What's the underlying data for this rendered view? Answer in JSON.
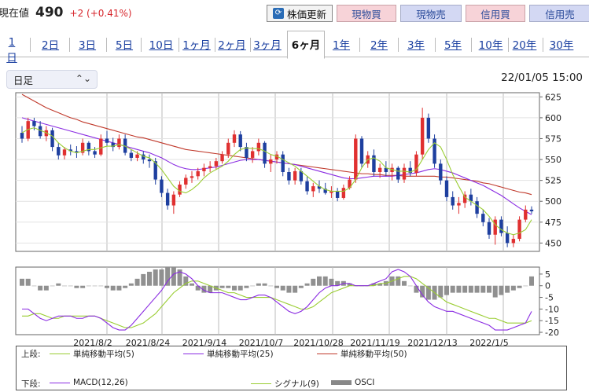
{
  "quote": {
    "label": "現在値",
    "price": "490",
    "change": "+2 (+0.41%)"
  },
  "buttons": {
    "update": "株価更新",
    "buy_cash": "現物買",
    "sell_cash": "現物売",
    "buy_margin": "信用買",
    "sell_margin": "信用売"
  },
  "tabs": [
    "1日",
    "2日",
    "3日",
    "5日",
    "10日",
    "1ヶ月",
    "2ヶ月",
    "3ヶ月",
    "6ヶ月",
    "1年",
    "2年",
    "3年",
    "5年",
    "10年",
    "20年",
    "30年"
  ],
  "active_tab": "6ヶ月",
  "period_select": "日足",
  "datetime": "22/01/05 15:00",
  "colors": {
    "up": "#e03030",
    "down": "#1e3f9f",
    "ma5": "#9acd32",
    "ma25": "#8a2be2",
    "ma50": "#c0392b",
    "macd": "#8a2be2",
    "signal": "#9acd32",
    "osci": "#909090"
  },
  "chart_data": [
    {
      "type": "line",
      "title": "",
      "price_axis": {
        "ticks": [
          "625",
          "600",
          "575",
          "550",
          "525",
          "500",
          "475",
          "450"
        ],
        "ylim": [
          440,
          630
        ]
      },
      "x_dates": [
        "2021/8/2",
        "2021/8/24",
        "2021/9/14",
        "2021/10/7",
        "2021/10/28",
        "2021/11/19",
        "2021/12/13",
        "2022/1/5"
      ],
      "candles": [
        [
          582,
          590,
          570,
          575
        ],
        [
          575,
          600,
          572,
          596
        ],
        [
          596,
          600,
          585,
          590
        ],
        [
          590,
          596,
          575,
          578
        ],
        [
          578,
          590,
          572,
          585
        ],
        [
          585,
          588,
          560,
          565
        ],
        [
          565,
          570,
          550,
          555
        ],
        [
          555,
          565,
          550,
          562
        ],
        [
          562,
          568,
          555,
          560
        ],
        [
          560,
          566,
          552,
          558
        ],
        [
          558,
          575,
          555,
          570
        ],
        [
          570,
          572,
          555,
          560
        ],
        [
          560,
          565,
          552,
          556
        ],
        [
          556,
          580,
          554,
          575
        ],
        [
          575,
          584,
          566,
          570
        ],
        [
          570,
          576,
          560,
          565
        ],
        [
          565,
          580,
          562,
          575
        ],
        [
          575,
          580,
          555,
          558
        ],
        [
          558,
          562,
          548,
          552
        ],
        [
          552,
          560,
          548,
          556
        ],
        [
          556,
          560,
          545,
          550
        ],
        [
          550,
          556,
          540,
          548
        ],
        [
          548,
          552,
          520,
          526
        ],
        [
          526,
          530,
          505,
          510
        ],
        [
          510,
          515,
          490,
          495
        ],
        [
          495,
          512,
          485,
          508
        ],
        [
          508,
          524,
          505,
          520
        ],
        [
          520,
          532,
          515,
          528
        ],
        [
          528,
          536,
          522,
          530
        ],
        [
          530,
          540,
          526,
          536
        ],
        [
          536,
          545,
          530,
          540
        ],
        [
          540,
          548,
          535,
          542
        ],
        [
          542,
          552,
          538,
          548
        ],
        [
          548,
          560,
          545,
          556
        ],
        [
          556,
          575,
          552,
          570
        ],
        [
          570,
          585,
          565,
          580
        ],
        [
          580,
          584,
          560,
          565
        ],
        [
          565,
          570,
          548,
          552
        ],
        [
          552,
          565,
          546,
          560
        ],
        [
          560,
          575,
          555,
          570
        ],
        [
          570,
          572,
          540,
          545
        ],
        [
          545,
          556,
          535,
          550
        ],
        [
          550,
          560,
          545,
          556
        ],
        [
          556,
          560,
          530,
          535
        ],
        [
          535,
          540,
          520,
          525
        ],
        [
          525,
          540,
          520,
          536
        ],
        [
          536,
          540,
          520,
          524
        ],
        [
          524,
          530,
          508,
          512
        ],
        [
          512,
          522,
          505,
          518
        ],
        [
          518,
          525,
          510,
          515
        ],
        [
          515,
          522,
          508,
          510
        ],
        [
          510,
          518,
          504,
          512
        ],
        [
          512,
          516,
          500,
          504
        ],
        [
          504,
          520,
          502,
          516
        ],
        [
          516,
          530,
          514,
          526
        ],
        [
          526,
          580,
          522,
          575
        ],
        [
          575,
          578,
          540,
          545
        ],
        [
          545,
          560,
          540,
          555
        ],
        [
          555,
          562,
          530,
          535
        ],
        [
          535,
          545,
          528,
          540
        ],
        [
          540,
          548,
          530,
          535
        ],
        [
          535,
          545,
          525,
          540
        ],
        [
          540,
          542,
          522,
          526
        ],
        [
          526,
          545,
          522,
          540
        ],
        [
          540,
          548,
          530,
          534
        ],
        [
          534,
          560,
          530,
          556
        ],
        [
          556,
          612,
          550,
          600
        ],
        [
          600,
          605,
          570,
          575
        ],
        [
          575,
          580,
          540,
          545
        ],
        [
          545,
          550,
          520,
          525
        ],
        [
          525,
          530,
          500,
          505
        ],
        [
          505,
          512,
          490,
          495
        ],
        [
          495,
          505,
          485,
          498
        ],
        [
          498,
          512,
          492,
          508
        ],
        [
          508,
          515,
          495,
          500
        ],
        [
          500,
          505,
          480,
          485
        ],
        [
          485,
          490,
          470,
          475
        ],
        [
          475,
          480,
          455,
          460
        ],
        [
          460,
          482,
          448,
          478
        ],
        [
          478,
          482,
          458,
          462
        ],
        [
          462,
          470,
          445,
          450
        ],
        [
          450,
          460,
          445,
          455
        ],
        [
          455,
          482,
          452,
          478
        ],
        [
          478,
          495,
          475,
          490
        ],
        [
          490,
          494,
          485,
          488
        ]
      ],
      "ma5": [
        582,
        586,
        588,
        585,
        582,
        578,
        570,
        564,
        560,
        558,
        560,
        562,
        562,
        564,
        566,
        566,
        568,
        566,
        562,
        558,
        554,
        552,
        546,
        538,
        528,
        518,
        512,
        510,
        514,
        520,
        528,
        534,
        538,
        542,
        548,
        556,
        562,
        564,
        563,
        563,
        560,
        556,
        554,
        550,
        546,
        542,
        536,
        530,
        524,
        518,
        514,
        512,
        512,
        512,
        516,
        526,
        540,
        550,
        552,
        548,
        540,
        538,
        536,
        536,
        535,
        538,
        550,
        562,
        570,
        565,
        550,
        532,
        518,
        505,
        500,
        495,
        490,
        482,
        472,
        466,
        462,
        460,
        462,
        466,
        478
      ],
      "ma25": [
        600,
        598,
        596,
        594,
        592,
        590,
        588,
        586,
        584,
        582,
        580,
        578,
        576,
        574,
        572,
        570,
        568,
        566,
        564,
        562,
        560,
        558,
        555,
        552,
        548,
        544,
        541,
        539,
        538,
        538,
        539,
        540,
        541,
        543,
        545,
        547,
        549,
        550,
        550,
        550,
        549,
        548,
        547,
        546,
        545,
        544,
        542,
        540,
        538,
        536,
        534,
        532,
        530,
        528,
        527,
        527,
        528,
        529,
        530,
        530,
        530,
        530,
        531,
        532,
        533,
        534,
        536,
        538,
        539,
        538,
        536,
        534,
        531,
        528,
        525,
        522,
        519,
        515,
        511,
        507,
        502,
        497,
        492,
        488,
        484
      ],
      "ma50": [
        628,
        624,
        620,
        616,
        612,
        609,
        606,
        603,
        600,
        598,
        595,
        593,
        591,
        589,
        587,
        585,
        583,
        581,
        579,
        577,
        576,
        574,
        572,
        570,
        568,
        566,
        564,
        562,
        561,
        560,
        559,
        558,
        557,
        556,
        555,
        554,
        553,
        552,
        551,
        550,
        549,
        548,
        547,
        546,
        545,
        544,
        543,
        542,
        541,
        540,
        539,
        538,
        537,
        536,
        535,
        534,
        533,
        533,
        532,
        532,
        531,
        531,
        531,
        530,
        530,
        530,
        530,
        530,
        530,
        529,
        529,
        528,
        527,
        526,
        525,
        524,
        522,
        521,
        519,
        517,
        515,
        513,
        511,
        510,
        508
      ]
    },
    {
      "type": "line",
      "title": "",
      "ticks": [
        "5",
        "0",
        "-5",
        "-10",
        "-15",
        "-20"
      ],
      "ylim": [
        -21,
        8
      ],
      "macd": [
        -10,
        -10,
        -12,
        -14,
        -15,
        -14,
        -13,
        -13,
        -13,
        -14,
        -14,
        -13,
        -13,
        -14,
        -16,
        -18,
        -19,
        -19,
        -17,
        -14,
        -11,
        -8,
        -5,
        -2,
        2,
        5,
        6,
        5,
        3,
        0,
        -2,
        -3,
        -3,
        -3,
        -4,
        -5,
        -6,
        -6,
        -5,
        -4,
        -4,
        -5,
        -7,
        -9,
        -11,
        -12,
        -11,
        -9,
        -6,
        -3,
        -1,
        0,
        0,
        1,
        1,
        0,
        0,
        0,
        1,
        2,
        3,
        6,
        7,
        6,
        4,
        0,
        -4,
        -7,
        -9,
        -10,
        -11,
        -11,
        -12,
        -13,
        -14,
        -15,
        -16,
        -17,
        -19,
        -19,
        -19,
        -18,
        -17,
        -16,
        -11
      ],
      "signal": [
        -13,
        -13,
        -12,
        -12,
        -13,
        -14,
        -14,
        -13,
        -13,
        -13,
        -13,
        -13,
        -13,
        -14,
        -15,
        -16,
        -17,
        -18,
        -18,
        -17,
        -16,
        -14,
        -12,
        -9,
        -6,
        -3,
        -1,
        1,
        2,
        2,
        1,
        0,
        -1,
        -2,
        -3,
        -3,
        -4,
        -5,
        -5,
        -5,
        -5,
        -5,
        -6,
        -7,
        -8,
        -9,
        -10,
        -10,
        -9,
        -7,
        -5,
        -3,
        -2,
        -1,
        0,
        0,
        0,
        0,
        0,
        1,
        1,
        2,
        3,
        4,
        4,
        3,
        1,
        -1,
        -3,
        -5,
        -7,
        -8,
        -9,
        -10,
        -11,
        -12,
        -13,
        -14,
        -14,
        -15,
        -16,
        -16,
        -16,
        -16,
        -15
      ],
      "osci": [
        3,
        3,
        0,
        -2,
        -2,
        0,
        1,
        0,
        0,
        -1,
        -1,
        0,
        0,
        0,
        -1,
        -2,
        -2,
        -1,
        1,
        3,
        5,
        6,
        7,
        7,
        8,
        8,
        7,
        4,
        1,
        -2,
        -3,
        -3,
        -2,
        -1,
        -1,
        -2,
        -2,
        -1,
        0,
        1,
        1,
        0,
        -1,
        -2,
        -3,
        -3,
        -1,
        1,
        3,
        4,
        4,
        3,
        2,
        2,
        1,
        0,
        0,
        0,
        1,
        1,
        2,
        4,
        4,
        2,
        0,
        -3,
        -5,
        -6,
        -6,
        -5,
        -4,
        -3,
        -3,
        -3,
        -3,
        -3,
        -3,
        -3,
        -5,
        -4,
        -3,
        -2,
        -1,
        0,
        4
      ]
    }
  ],
  "legend": {
    "upper_label": "上段:",
    "lower_label": "下段:",
    "ma5": "単純移動平均(5)",
    "ma25": "単純移動平均(25)",
    "ma50": "単純移動平均(50)",
    "macd": "MACD(12,26)",
    "signal": "シグナル(9)",
    "osci": "OSCI"
  }
}
